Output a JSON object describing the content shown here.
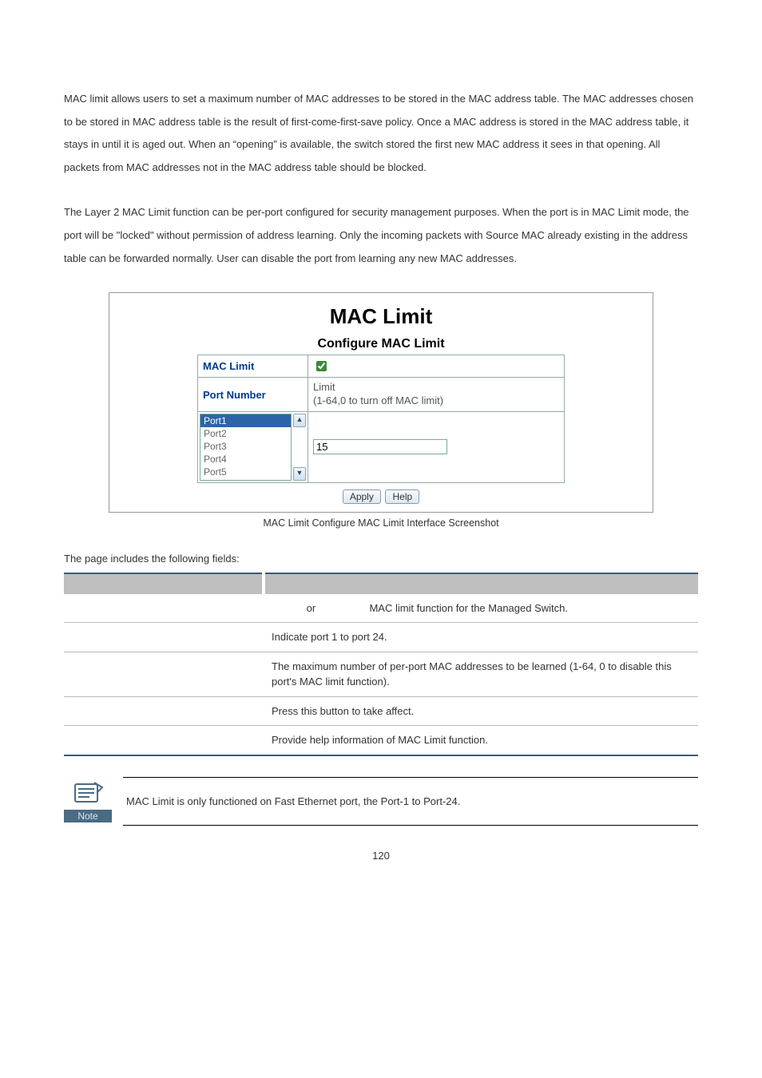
{
  "paragraph1": "MAC limit allows users to set a maximum number of MAC addresses to be stored in the MAC address table. The MAC addresses chosen to be stored in MAC address table is the result of first-come-first-save policy. Once a MAC address is stored in the MAC address table, it stays in until it is aged out. When an “opening” is available, the switch stored the first new MAC address it sees in that opening. All packets from MAC addresses not in the MAC address table should be blocked.",
  "paragraph2": "The Layer 2 MAC Limit function can be per-port configured for security management purposes. When the port is in MAC Limit mode, the port will be \"locked\" without permission of address learning. Only the incoming packets with Source MAC already existing in the address table can be forwarded normally. User can disable the port from learning any new MAC addresses.",
  "panel": {
    "title": "MAC Limit",
    "subtitle": "Configure MAC Limit",
    "row1_label": "MAC Limit",
    "row2_label": "Port Number",
    "row2_hint_line1": "Limit",
    "row2_hint_line2": "(1-64,0 to turn off MAC limit)",
    "ports": [
      "Port1",
      "Port2",
      "Port3",
      "Port4",
      "Port5"
    ],
    "value": "15",
    "apply": "Apply",
    "help": "Help"
  },
  "caption": "MAC Limit   Configure MAC Limit Interface Screenshot",
  "fields_intro": "The page includes the following fields:",
  "desc": {
    "r1a": "or",
    "r1b": "MAC limit function for the Managed Switch.",
    "r2": "Indicate port 1 to port 24.",
    "r3": "The maximum number of per-port MAC addresses to be learned (1-64, 0 to disable this port's MAC limit function).",
    "r4": "Press this button to take affect.",
    "r5": "Provide help information of MAC Limit function."
  },
  "note_label": "Note",
  "note_text": "MAC Limit is only functioned on Fast Ethernet port, the Port-1 to Port-24.",
  "page_number": "120"
}
